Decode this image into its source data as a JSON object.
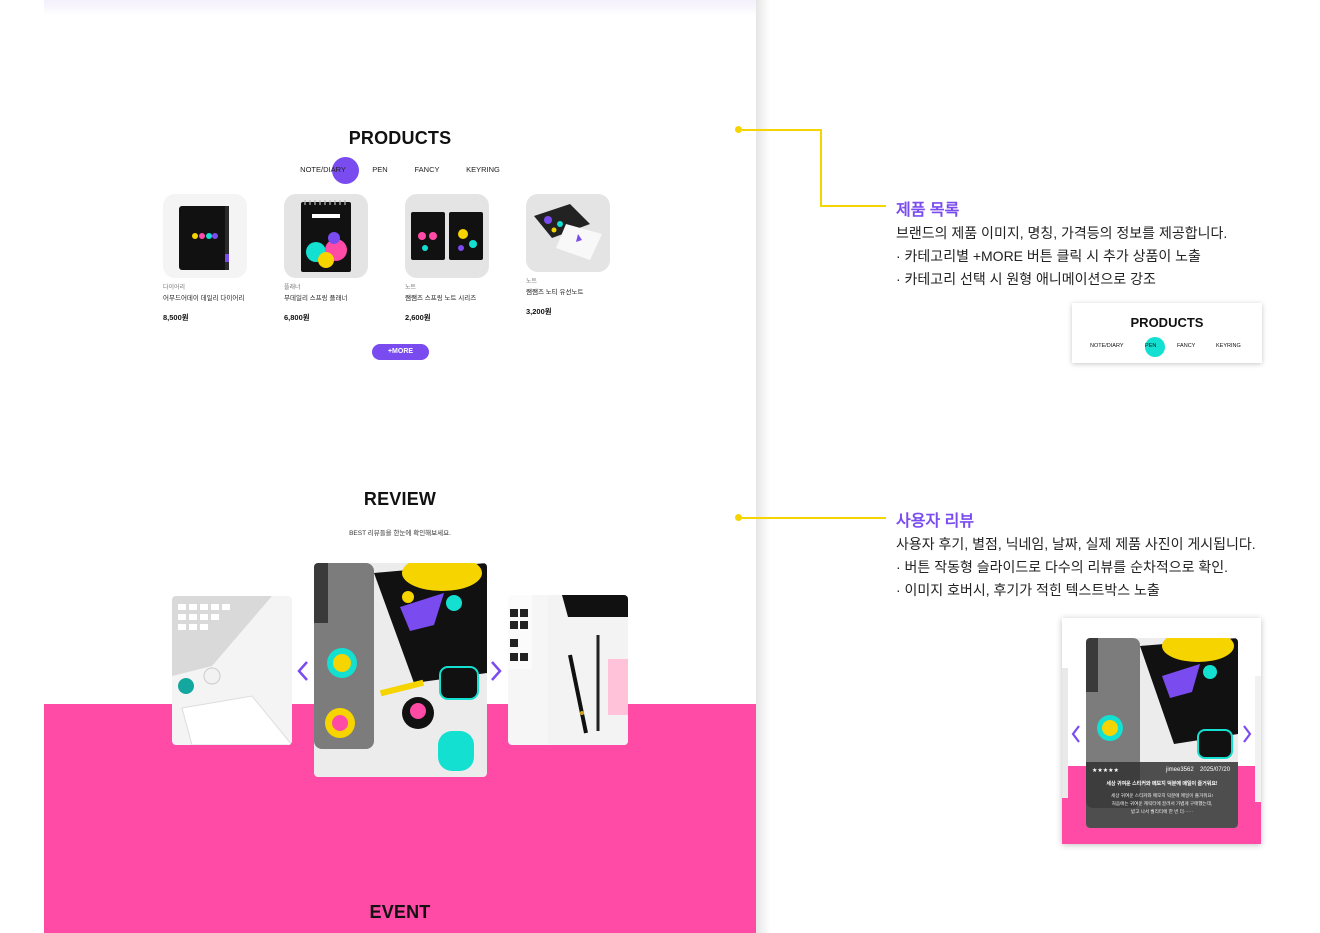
{
  "products_section": {
    "title": "PRODUCTS",
    "tabs": [
      "NOTE/DIARY",
      "PEN",
      "FANCY",
      "KEYRING"
    ],
    "active_tab": "NOTE/DIARY",
    "items": [
      {
        "category": "다이어리",
        "name": "어무드어데이 데일리 다이어리",
        "price": "8,500원"
      },
      {
        "category": "플래너",
        "name": "무데일리 스프링 플래너",
        "price": "6,800원"
      },
      {
        "category": "노트",
        "name": "쨈쨈즈 스프링 노트 시리즈",
        "price": "2,600원"
      },
      {
        "category": "노트",
        "name": "쨈쨈즈 노티 유선노트",
        "price": "3,200원"
      }
    ],
    "more_label": "+MORE"
  },
  "review_section": {
    "title": "REVIEW",
    "subtitle": "BEST 리뷰들을 한눈에 확인해보세요.",
    "prev_icon": "chevron-left-icon",
    "next_icon": "chevron-right-icon"
  },
  "event_section": {
    "title": "EVENT"
  },
  "annotations": {
    "products": {
      "title": "제품 목록",
      "lines": [
        "브랜드의 제품 이미지, 명칭, 가격등의 정보를 제공합니다.",
        "· 카테고리별 +MORE 버튼 클릭 시 추가 상품이 노출",
        "· 카테고리 선택 시 원형 애니메이션으로 강조"
      ],
      "preview": {
        "title": "PRODUCTS",
        "tabs": [
          "NOTE/DIARY",
          "PEN",
          "FANCY",
          "KEYRING"
        ],
        "active_tab": "PEN"
      }
    },
    "review": {
      "title": "사용자 리뷰",
      "lines": [
        "사용자 후기, 별점, 닉네임, 날짜, 실제 제품 사진이 게시됩니다.",
        "· 버튼 작동형 슬라이드로 다수의 리뷰를 순차적으로 확인.",
        "· 이미지 호버시, 후기가 적힌 텍스트박스 노출"
      ],
      "preview": {
        "stars": "★★★★★",
        "nickname": "jimee3562",
        "date": "2025/07/20",
        "headline": "세상 귀여운 스티커와 메모지 덕분에 매일이 즐거워요!",
        "body_1": "세상 귀여운 스티커와 메모지 덕분에 매일이 즐거워요!",
        "body_2": "처음에는 귀여운 캐릭터에 끌려서 가볍게 구매했는데,",
        "body_3": "받고 나서 퀄리티에 한 번 더······"
      }
    }
  },
  "colors": {
    "accent": "#7a4cf0",
    "pink": "#ff4aa6",
    "yellow": "#f5d400",
    "mint": "#13e0d0"
  }
}
